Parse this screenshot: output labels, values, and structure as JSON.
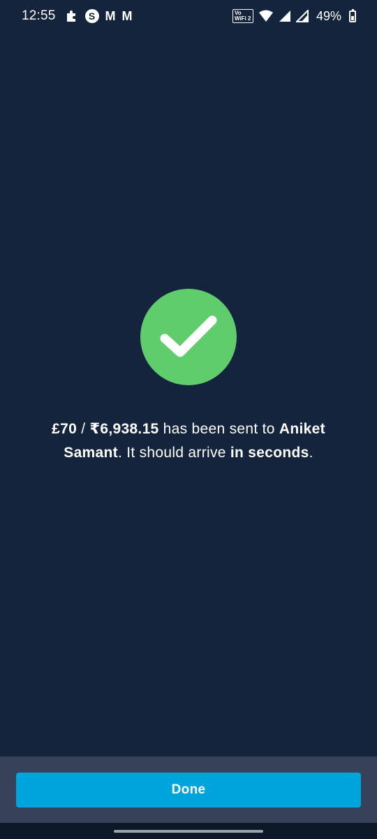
{
  "status_bar": {
    "time": "12:55",
    "notification_icons": [
      "puzzle-icon",
      "s-circle-icon",
      "gmail-icon",
      "gmail-icon"
    ],
    "s_letter": "S",
    "m_letter_1": "M",
    "m_letter_2": "M",
    "vowifi_line1": "Vo",
    "vowifi_line2": "WiFi 2",
    "battery_percent": "49%"
  },
  "confirmation": {
    "amount_gbp": "£70",
    "separator": " / ",
    "amount_inr": "₹6,938.15",
    "text_sent_to": " has been sent to ",
    "recipient": "Aniket Samant",
    "text_arrive": ". It should arrive ",
    "arrival": "in seconds",
    "text_end": "."
  },
  "actions": {
    "done_label": "Done"
  },
  "colors": {
    "background": "#14243d",
    "success_green": "#60cd6d",
    "button_blue": "#00a4dd",
    "bottom_panel": "#35425a"
  }
}
